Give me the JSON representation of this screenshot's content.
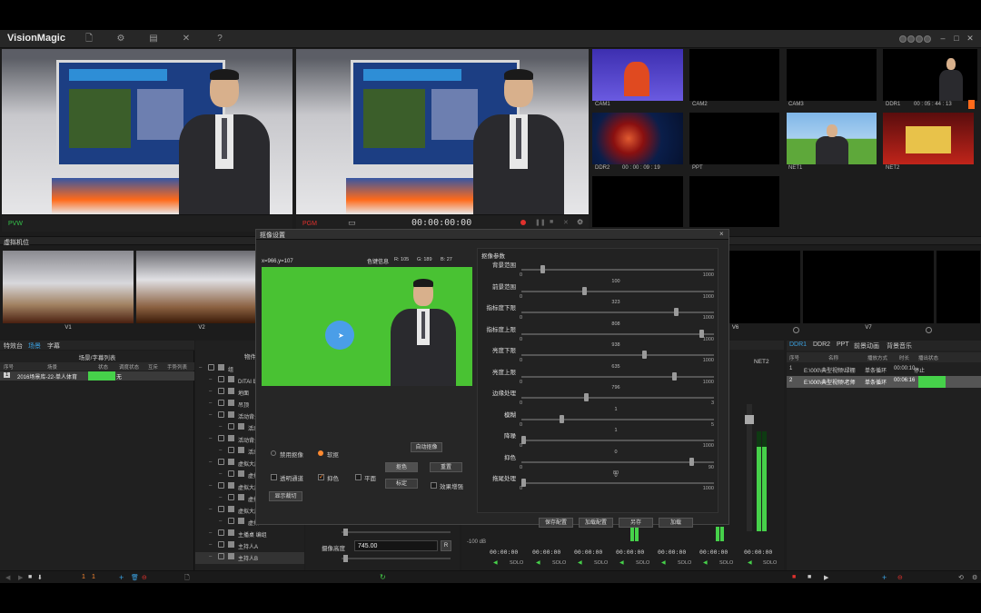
{
  "app": {
    "title": "VisionMagic"
  },
  "toolbar_icons": [
    "file-icon",
    "gear-icon",
    "list-icon",
    "tools-icon",
    "help-icon"
  ],
  "toolbar_glyphs": [
    "🗋",
    "⚙",
    "▤",
    "✕",
    "?"
  ],
  "window_buttons": {
    "minimize": "–",
    "maximize": "□",
    "close": "✕"
  },
  "pvw": {
    "label": "PVW"
  },
  "pgm": {
    "label": "PGM",
    "timecode": "00:00:00:00"
  },
  "sources": [
    {
      "label": "CAM1"
    },
    {
      "label": "CAM2"
    },
    {
      "label": "CAM3"
    },
    {
      "label": "DDR1",
      "timecode": "00 : 05 : 44 : 13"
    },
    {
      "label": "DDR2",
      "timecode": "00 : 00 : 09 : 19"
    },
    {
      "label": "PPT"
    },
    {
      "label": "NET1"
    },
    {
      "label": "NET2"
    }
  ],
  "virtual_cams": {
    "title": "虚拟机位",
    "items": [
      "V1",
      "V2",
      "V6",
      "V7"
    ]
  },
  "scene_panel": {
    "tabs": [
      "特效台",
      "场景",
      "字幕"
    ],
    "list_title": "场景/字幕列表",
    "columns": [
      "序号",
      "场景",
      "状态",
      "调度状态",
      "互斥",
      "手势列表"
    ],
    "rows": [
      {
        "index": "1",
        "name": "2016场景库-22-单人体育",
        "status": "",
        "schedule": "无"
      }
    ]
  },
  "object_panel": {
    "title": "物件列表",
    "items": [
      {
        "text": "组",
        "indent": 0
      },
      {
        "text": "DITAI 组",
        "indent": 1
      },
      {
        "text": "地面",
        "indent": 1
      },
      {
        "text": "吊顶",
        "indent": 1
      },
      {
        "text": "活动背景",
        "indent": 1
      },
      {
        "text": "活动",
        "indent": 2
      },
      {
        "text": "活动背景",
        "indent": 1
      },
      {
        "text": "活动",
        "indent": 2
      },
      {
        "text": "虚拟大屏",
        "indent": 1
      },
      {
        "text": "虚拟",
        "indent": 2
      },
      {
        "text": "虚拟大屏",
        "indent": 1
      },
      {
        "text": "虚拟",
        "indent": 2
      },
      {
        "text": "虚拟大屏",
        "indent": 1
      },
      {
        "text": "虚拟",
        "indent": 2
      },
      {
        "text": "主播桌 编组",
        "indent": 1
      },
      {
        "text": "主持人A",
        "indent": 1
      },
      {
        "text": "主持人B",
        "indent": 1
      }
    ]
  },
  "camera_height": {
    "label": "摄像高度",
    "value": "745.00"
  },
  "keyer_dialog": {
    "title": "抠像设置",
    "coords": "x=966,y=107",
    "color_info": {
      "label": "色键信息",
      "r": "R: 105",
      "g": "G: 189",
      "b": "B: 27"
    },
    "params_title": "抠像参数",
    "sliders": [
      {
        "name": "背景范围",
        "value": "",
        "min": "0",
        "max": "1000",
        "pos": 0.1
      },
      {
        "name": "前景范围",
        "value": "100",
        "min": "0",
        "max": "1000",
        "pos": 0.32
      },
      {
        "name": "指标度下限",
        "value": "323",
        "min": "0",
        "max": "1000",
        "pos": 0.81
      },
      {
        "name": "指标度上限",
        "value": "808",
        "min": "0",
        "max": "1000",
        "pos": 0.94
      },
      {
        "name": "亮度下限",
        "value": "938",
        "min": "0",
        "max": "1000",
        "pos": 0.64
      },
      {
        "name": "亮度上限",
        "value": "635",
        "min": "0",
        "max": "1000",
        "pos": 0.8
      },
      {
        "name": "边缘处理",
        "value": "796",
        "min": "0",
        "max": "3",
        "pos": 0.33
      },
      {
        "name": "模糊",
        "value": "1",
        "min": "0",
        "max": "5",
        "pos": 0.2
      },
      {
        "name": "降噪",
        "value": "1",
        "min": "0",
        "max": "1000",
        "pos": 0.0
      },
      {
        "name": "抑色",
        "value": "0",
        "min": "0",
        "max": "90",
        "pos": 0.89
      },
      {
        "name": "拖尾处理",
        "value": "80",
        "min": "0",
        "max": "1000",
        "pos": 0.0
      }
    ],
    "last_value": "0",
    "options": {
      "disable_key": "禁用抠像",
      "soft_key": "软抠",
      "auto_key": "自动抠像",
      "transparent": "透明通道",
      "suppress": "抑色",
      "flatten": "平面",
      "key_color": "抠色",
      "reset": "重置",
      "mark": "标定",
      "enhance": "效果增强",
      "show_crop": "显示裁切"
    },
    "footer_buttons": [
      "保存配置",
      "加载配置",
      "另存",
      "加载"
    ]
  },
  "audio": {
    "db_label": "-100 dB",
    "net_label": "NET2",
    "timecodes": [
      "00:00:00",
      "00:00:00",
      "00:00:00",
      "00:00:00",
      "00:00:00",
      "00:00:00"
    ],
    "solo": "SOLO"
  },
  "ddr_panel": {
    "tabs": [
      "DDR1",
      "DDR2",
      "PPT",
      "前景动画",
      "背景音乐"
    ],
    "columns": [
      "序号",
      "名称",
      "播放方式",
      "时长",
      "播出状态"
    ],
    "rows": [
      {
        "index": "1",
        "name": "E:\\000\\典型视频\\绿棚",
        "mode": "单条循环",
        "duration": "00:00:10",
        "status": "停止"
      },
      {
        "index": "2",
        "name": "E:\\000\\典型视频\\老师",
        "mode": "单条循环",
        "duration": "00:06:16",
        "status": ""
      }
    ]
  },
  "bottom": {
    "num_left": "1",
    "num_right": "1"
  },
  "colors": {
    "accent_green": "#34c24a",
    "accent_red": "#e0312d",
    "ddr_tab": "#3aa0e0"
  }
}
